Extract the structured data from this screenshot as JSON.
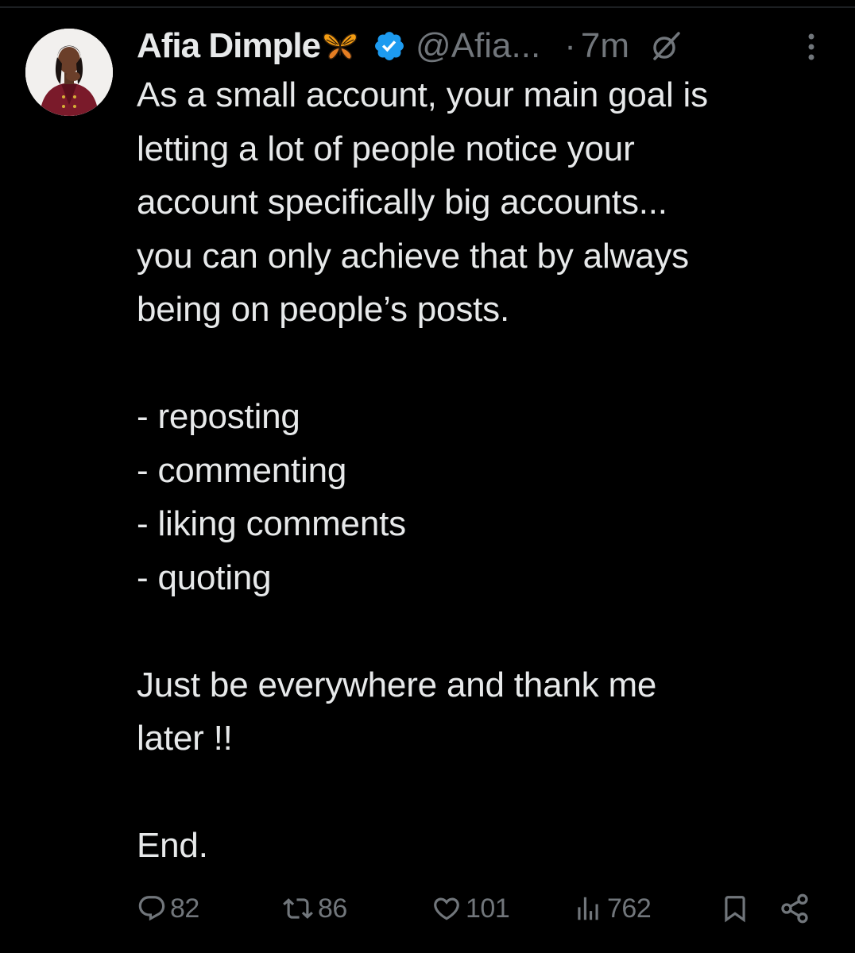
{
  "author": {
    "name": "Afia Dimple",
    "handle": "@Afia...",
    "separator": "·",
    "time": "7m",
    "emoji_icon": "butterfly-icon",
    "verified_icon": "verified-badge-icon"
  },
  "colors": {
    "background": "#000000",
    "text": "#e7e9ea",
    "muted": "#71767b",
    "verified_blue": "#1d9bf0"
  },
  "post": {
    "lines": [
      "As a small account, your main goal is",
      "letting a lot of people notice your",
      "account specifically big accounts...",
      "you can only achieve that by always",
      "being on people’s posts.",
      "",
      "- reposting",
      "- commenting",
      "- liking comments",
      "- quoting",
      "",
      "Just be everywhere and thank me",
      "later !!",
      "",
      "End."
    ]
  },
  "actions": {
    "replies": "82",
    "reposts": "86",
    "likes": "101",
    "views": "762"
  }
}
